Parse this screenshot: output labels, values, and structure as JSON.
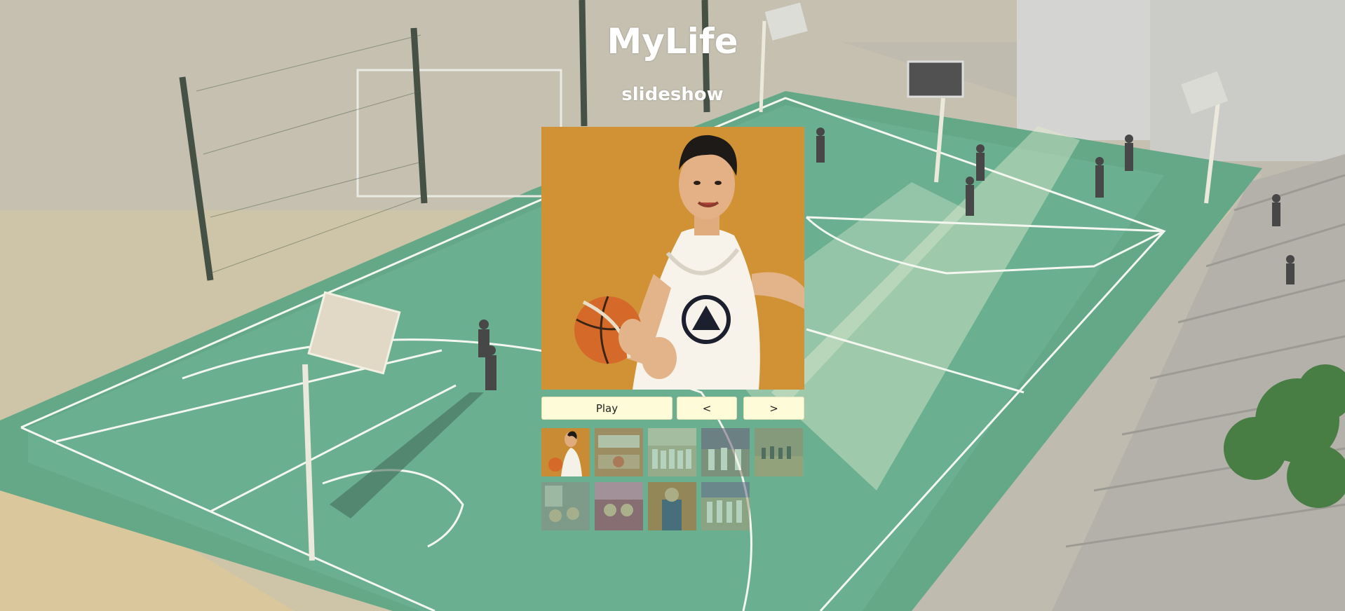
{
  "header": {
    "title": "MyLife",
    "subtitle": "slideshow"
  },
  "slideshow": {
    "current_index": 0,
    "controls": {
      "play_label": "Play",
      "prev_label": "<",
      "next_label": ">"
    },
    "thumbnails": [
      {
        "name": "thumbnail-1",
        "active": true
      },
      {
        "name": "thumbnail-2",
        "active": false
      },
      {
        "name": "thumbnail-3",
        "active": false
      },
      {
        "name": "thumbnail-4",
        "active": false
      },
      {
        "name": "thumbnail-5",
        "active": false
      },
      {
        "name": "thumbnail-6",
        "active": false
      },
      {
        "name": "thumbnail-7",
        "active": false
      },
      {
        "name": "thumbnail-8",
        "active": false
      },
      {
        "name": "thumbnail-9",
        "active": false
      }
    ]
  },
  "colors": {
    "button_bg": "#fdfbd8",
    "title_text": "#ffffff",
    "court_green": "#3f8f6a"
  }
}
